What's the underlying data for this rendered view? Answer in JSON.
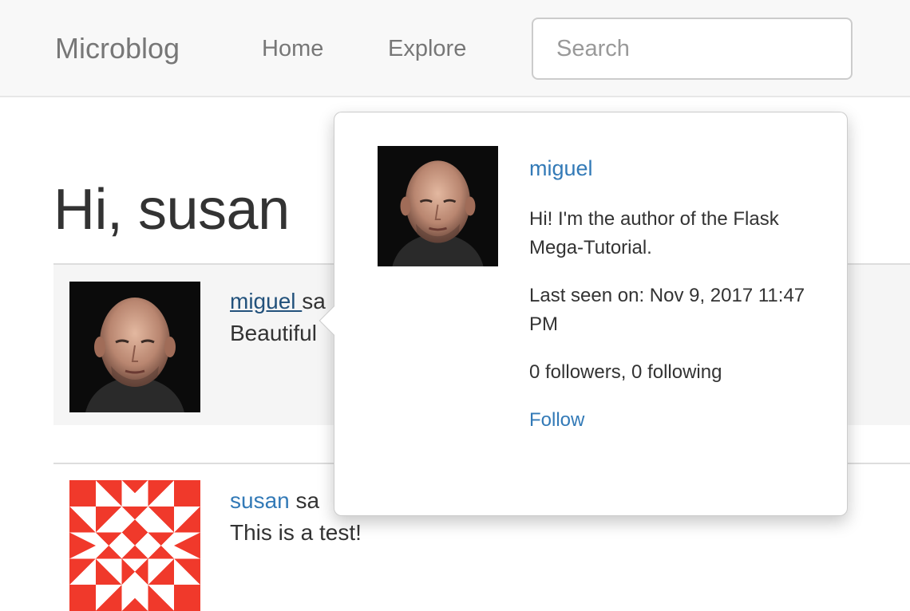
{
  "navbar": {
    "brand": "Microblog",
    "home": "Home",
    "explore": "Explore",
    "search_placeholder": "Search"
  },
  "main": {
    "greeting": "Hi, susan",
    "posts": [
      {
        "author": "miguel",
        "says": "said",
        "visible_author": "miguel ",
        "visible_says": "sa",
        "body": "Beautiful"
      },
      {
        "author": "susan",
        "visible_says": "sa",
        "body": "This is a test!"
      }
    ]
  },
  "popover": {
    "username": "miguel",
    "about": "Hi! I'm the author of the Flask Mega-Tutorial.",
    "last_seen": "Last seen on: Nov 9, 2017 11:47 PM",
    "stats": "0 followers, 0 following",
    "follow": "Follow"
  },
  "colors": {
    "link": "#337ab7",
    "identicon": "#f0392b",
    "navbar_bg": "#f8f8f8"
  }
}
